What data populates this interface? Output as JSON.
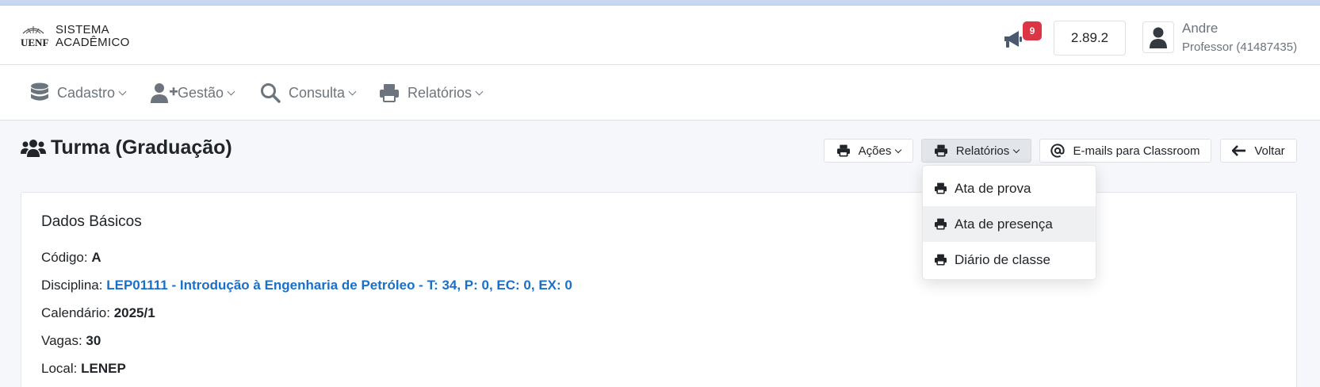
{
  "header": {
    "logo_line1": "SISTEMA",
    "logo_line2": "ACADÊMICO",
    "logo_mark_text": "UENF",
    "notifications_count": "9",
    "version": "2.89.2",
    "user_name": "Andre",
    "user_role": "Professor (41487435)"
  },
  "nav": {
    "items": [
      {
        "label": "Cadastro",
        "icon": "database-icon"
      },
      {
        "label": "Gestão",
        "icon": "user-plus-icon"
      },
      {
        "label": "Consulta",
        "icon": "search-icon"
      },
      {
        "label": "Relatórios",
        "icon": "printer-icon"
      }
    ]
  },
  "page": {
    "title": "Turma (Graduação)",
    "actions": {
      "acoes": "Ações",
      "relatorios": "Relatórios",
      "emails": "E-mails para Classroom",
      "voltar": "Voltar"
    }
  },
  "dropdown": {
    "items": [
      "Ata de prova",
      "Ata de presença",
      "Diário de classe"
    ]
  },
  "card": {
    "title": "Dados Básicos",
    "fields": [
      {
        "label": "Código:",
        "value": "A"
      },
      {
        "label": "Disciplina:",
        "value": "LEP01111 - Introdução à Engenharia de Petróleo - T: 34, P: 0, EC: 0, EX: 0"
      },
      {
        "label": "Calendário:",
        "value": "2025/1"
      },
      {
        "label": "Vagas:",
        "value": "30"
      },
      {
        "label": "Local:",
        "value": "LENEP"
      }
    ]
  },
  "colors": {
    "link": "#1a6fc9",
    "badge": "#dc3545",
    "muted": "#6c757d"
  }
}
